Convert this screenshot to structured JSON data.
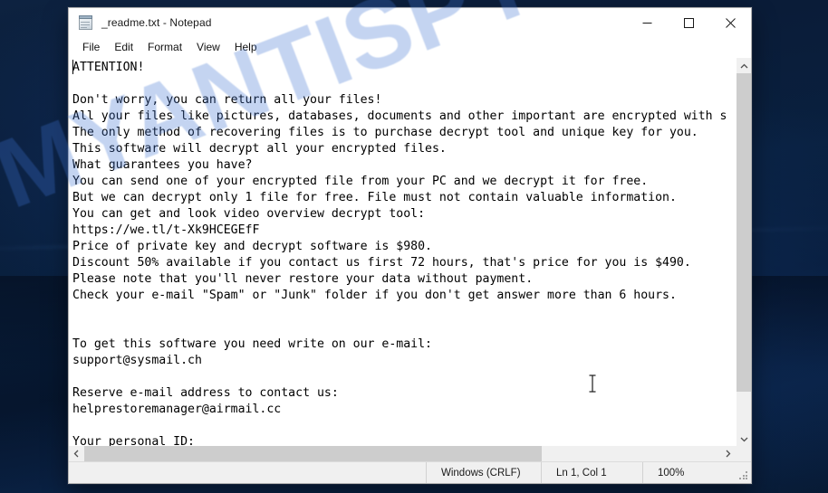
{
  "desktop": {
    "wallpaper_tone": "#0a1c38"
  },
  "watermark": {
    "text": "MYANTISPYWARE.COM",
    "color": "#3a70d2"
  },
  "window": {
    "title": "_readme.txt - Notepad",
    "icon": "notepad-icon",
    "controls": {
      "minimize": "Minimize",
      "maximize": "Maximize",
      "close": "Close"
    }
  },
  "menu": {
    "items": [
      {
        "label": "File"
      },
      {
        "label": "Edit"
      },
      {
        "label": "Format"
      },
      {
        "label": "View"
      },
      {
        "label": "Help"
      }
    ]
  },
  "document": {
    "filename": "_readme.txt",
    "lines": [
      "ATTENTION!",
      "",
      "Don't worry, you can return all your files!",
      "All your files like pictures, databases, documents and other important are encrypted with s",
      "The only method of recovering files is to purchase decrypt tool and unique key for you.",
      "This software will decrypt all your encrypted files.",
      "What guarantees you have?",
      "You can send one of your encrypted file from your PC and we decrypt it for free.",
      "But we can decrypt only 1 file for free. File must not contain valuable information.",
      "You can get and look video overview decrypt tool:",
      "https://we.tl/t-Xk9HCEGEfF",
      "Price of private key and decrypt software is $980.",
      "Discount 50% available if you contact us first 72 hours, that's price for you is $490.",
      "Please note that you'll never restore your data without payment.",
      "Check your e-mail \"Spam\" or \"Junk\" folder if you don't get answer more than 6 hours.",
      "",
      "",
      "To get this software you need write on our e-mail:",
      "support@sysmail.ch",
      "",
      "Reserve e-mail address to contact us:",
      "helprestoremanager@airmail.cc",
      "",
      "Your personal ID:"
    ],
    "contact_email": "support@sysmail.ch",
    "reserve_email": "helprestoremanager@airmail.cc",
    "video_url": "https://we.tl/t-Xk9HCEGEfF",
    "price_full": "$980",
    "price_discount": "$490",
    "discount_percent": "50%",
    "discount_window_hours": "72",
    "answer_window_hours": "6"
  },
  "statusbar": {
    "line_ending": "Windows (CRLF)",
    "cursor_position": "Ln 1, Col 1",
    "zoom": "100%"
  },
  "scrollbars": {
    "vertical": {
      "up_arrow": "chevron-up-icon",
      "down_arrow": "chevron-down-icon"
    },
    "horizontal": {
      "left_arrow": "chevron-left-icon",
      "right_arrow": "chevron-right-icon"
    }
  }
}
